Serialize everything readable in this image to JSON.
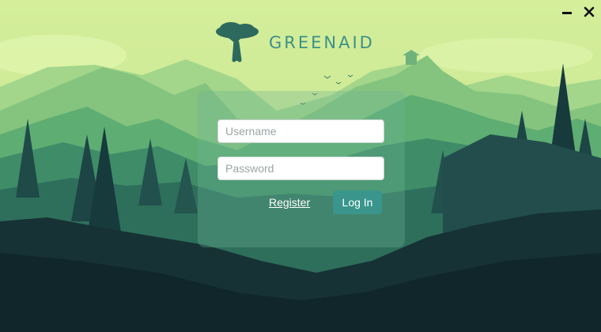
{
  "window": {
    "minimize_icon": "minimize-icon",
    "close_icon": "close-icon"
  },
  "brand": {
    "name": "GREENAID",
    "logo_icon": "tree-icon",
    "color": "#3d9088"
  },
  "form": {
    "username_placeholder": "Username",
    "username_value": "",
    "password_placeholder": "Password",
    "password_value": "",
    "register_label": "Register",
    "login_label": "Log In"
  },
  "colors": {
    "sky": "#dcf0a0",
    "accent": "#3a968c",
    "dark": "#142628"
  }
}
